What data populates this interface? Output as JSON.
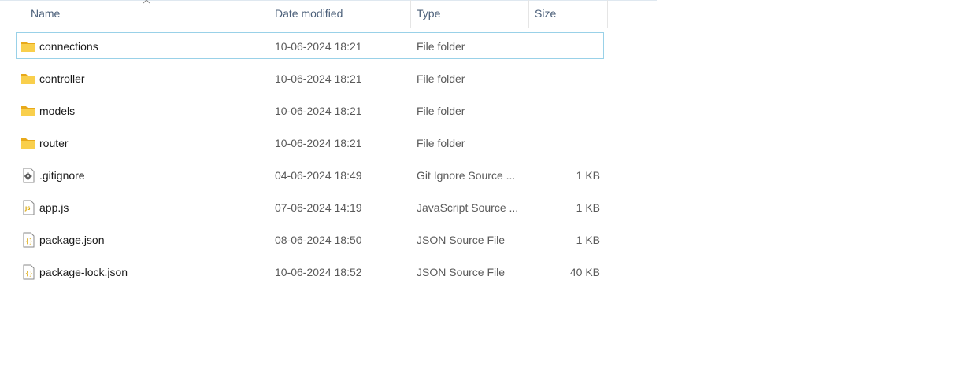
{
  "columns": {
    "name": "Name",
    "date_modified": "Date modified",
    "type": "Type",
    "size": "Size"
  },
  "sort": {
    "column": "Name",
    "direction": "ascending",
    "icon": "chevron-up-icon"
  },
  "files": [
    {
      "name": "connections",
      "date": "10-06-2024 18:21",
      "type": "File folder",
      "size": "",
      "icon": "folder-icon",
      "selected": true
    },
    {
      "name": "controller",
      "date": "10-06-2024 18:21",
      "type": "File folder",
      "size": "",
      "icon": "folder-icon"
    },
    {
      "name": "models",
      "date": "10-06-2024 18:21",
      "type": "File folder",
      "size": "",
      "icon": "folder-icon"
    },
    {
      "name": "router",
      "date": "10-06-2024 18:21",
      "type": "File folder",
      "size": "",
      "icon": "folder-icon"
    },
    {
      "name": ".gitignore",
      "date": "04-06-2024 18:49",
      "type": "Git Ignore Source ...",
      "size": "1 KB",
      "icon": "gear-file-icon"
    },
    {
      "name": "app.js",
      "date": "07-06-2024 14:19",
      "type": "JavaScript Source ...",
      "size": "1 KB",
      "icon": "js-file-icon"
    },
    {
      "name": "package.json",
      "date": "08-06-2024 18:50",
      "type": "JSON Source File",
      "size": "1 KB",
      "icon": "json-file-icon"
    },
    {
      "name": "package-lock.json",
      "date": "10-06-2024 18:52",
      "type": "JSON Source File",
      "size": "40 KB",
      "icon": "json-file-icon"
    }
  ],
  "colors": {
    "folder": "#f5c542",
    "selection_border": "#99d1e8",
    "header_text": "#4c607a"
  }
}
